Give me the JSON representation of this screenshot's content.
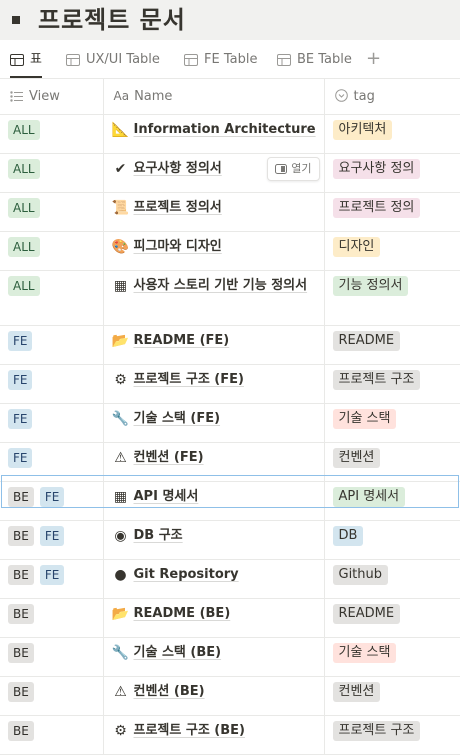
{
  "page": {
    "title": "프로젝트 문서"
  },
  "tabs": [
    {
      "label": "표",
      "icon": "table-icon",
      "active": true
    },
    {
      "label": "UX/UI Table",
      "icon": "table-icon",
      "active": false
    },
    {
      "label": "FE Table",
      "icon": "table-icon",
      "active": false
    },
    {
      "label": "BE Table",
      "icon": "table-icon",
      "active": false
    }
  ],
  "add_tab_label": "+",
  "columns": {
    "view": "View",
    "name": "Name",
    "tag": "tag"
  },
  "open_label": "열기",
  "colors": {
    "ALL": "#dbeddb",
    "FE": "#d3e5ef",
    "BE": "#e3e2e0",
    "tag_orange": "#fadec9",
    "tag_yellow": "#fdecc8",
    "tag_pink": "#f5e0e9",
    "tag_green": "#dbeddb",
    "tag_blue": "#d3e5ef",
    "tag_gray": "#e3e2e0",
    "tag_red": "#ffe2dd"
  },
  "rows": [
    {
      "views": [
        "ALL"
      ],
      "icon": "📐",
      "icon_name": "triangular-ruler-icon",
      "name": "Information Architecture",
      "tag": "아키텍처",
      "tag_color": "#fdecc8"
    },
    {
      "views": [
        "ALL"
      ],
      "icon": "✔",
      "icon_name": "check-mark-icon",
      "name": "요구사항 정의서",
      "tag": "요구사항 정의",
      "tag_color": "#f5e0e9",
      "show_open": true
    },
    {
      "views": [
        "ALL"
      ],
      "icon": "📜",
      "icon_name": "scroll-icon",
      "name": "프로젝트 정의서",
      "tag": "프로젝트 정의",
      "tag_color": "#f5e0e9"
    },
    {
      "views": [
        "ALL"
      ],
      "icon": "🎨",
      "icon_name": "palette-icon",
      "name": "피그마와 디자인",
      "tag": "디자인",
      "tag_color": "#fdecc8"
    },
    {
      "views": [
        "ALL"
      ],
      "icon": "▦",
      "icon_name": "notebook-icon",
      "name": "사용자 스토리 기반 기능 정의서",
      "tag": "기능 정의서",
      "tag_color": "#dbeddb",
      "tall": true
    },
    {
      "views": [
        "FE"
      ],
      "icon": "📂",
      "icon_name": "folder-icon",
      "name": "README (FE)",
      "tag": "README",
      "tag_color": "#e3e2e0"
    },
    {
      "views": [
        "FE"
      ],
      "icon": "⚙",
      "icon_name": "gear-icon",
      "name": "프로젝트 구조 (FE)",
      "tag": "프로젝트 구조",
      "tag_color": "#e3e2e0"
    },
    {
      "views": [
        "FE"
      ],
      "icon": "🔧",
      "icon_name": "wrench-icon",
      "name": "기술 스택 (FE)",
      "tag": "기술 스택",
      "tag_color": "#ffe2dd"
    },
    {
      "views": [
        "FE"
      ],
      "icon": "⚠",
      "icon_name": "warning-icon",
      "name": "컨벤션 (FE)",
      "tag": "컨벤션",
      "tag_color": "#e3e2e0"
    },
    {
      "views": [
        "BE",
        "FE"
      ],
      "icon": "▦",
      "icon_name": "notebook-icon",
      "name": "API 명세서",
      "tag": "API 명세서",
      "tag_color": "#dbeddb"
    },
    {
      "views": [
        "BE",
        "FE"
      ],
      "icon": "◉",
      "icon_name": "database-icon",
      "name": "DB 구조",
      "tag": "DB",
      "tag_color": "#d3e5ef",
      "selected": true
    },
    {
      "views": [
        "BE",
        "FE"
      ],
      "icon": "●",
      "icon_name": "github-icon",
      "name": "Git Repository",
      "tag": "Github",
      "tag_color": "#e3e2e0"
    },
    {
      "views": [
        "BE"
      ],
      "icon": "📂",
      "icon_name": "folder-icon",
      "name": "README (BE)",
      "tag": "README",
      "tag_color": "#e3e2e0"
    },
    {
      "views": [
        "BE"
      ],
      "icon": "🔧",
      "icon_name": "wrench-icon",
      "name": "기술 스택 (BE)",
      "tag": "기술 스택",
      "tag_color": "#ffe2dd"
    },
    {
      "views": [
        "BE"
      ],
      "icon": "⚠",
      "icon_name": "warning-icon",
      "name": "컨벤션 (BE)",
      "tag": "컨벤션",
      "tag_color": "#e3e2e0"
    },
    {
      "views": [
        "BE"
      ],
      "icon": "⚙",
      "icon_name": "gear-icon",
      "name": "프로젝트 구조 (BE)",
      "tag": "프로젝트 구조",
      "tag_color": "#e3e2e0"
    }
  ]
}
